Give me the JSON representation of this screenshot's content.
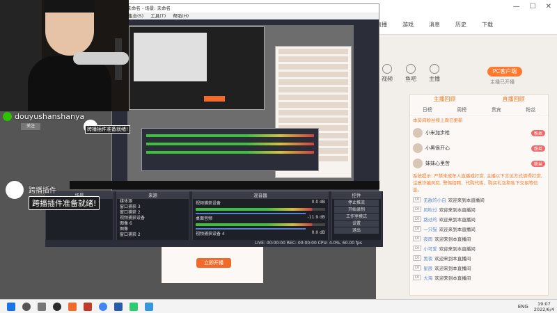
{
  "obs": {
    "title": "文件: 未命名 - 场景: 未命名",
    "menu": [
      "场景集合(S)",
      "工具(T)",
      "帮助(H)"
    ],
    "docks": {
      "scenes": {
        "header": "场景",
        "items": [
          "场景 2",
          "场景 3"
        ]
      },
      "sources": {
        "header": "来源",
        "items": [
          "媒体源",
          "窗口捕获 3",
          "窗口捕获 2",
          "视频捕获设备",
          "图像 6",
          "图像",
          "窗口捕获 2"
        ]
      },
      "mixer": {
        "header": "混音器",
        "rows": [
          {
            "name": "视频捕获设备",
            "level": "0.0 dB"
          },
          {
            "name": "桌面音频",
            "level": "-11.9 dB"
          },
          {
            "name": "视频捕获设备 4",
            "level": "0.0 dB"
          }
        ]
      },
      "controls": {
        "header": "控件",
        "buttons": [
          "停止推流",
          "开始录制",
          "工作室模式",
          "设置",
          "退出"
        ],
        "tab_left": "控件",
        "tab_right": "场景切换"
      }
    },
    "status": "LIVE: 00:00:00   REC: 00:00:00   CPU: 4.0%, 60.00 fps"
  },
  "overlay": {
    "wechat_name": "douyushanshanya",
    "wechat_sub": "关注",
    "ready_small": "跨播插件准备就绪!",
    "plugin_name": "跨播插件",
    "plugin_message": "跨播插件准备就绪!"
  },
  "page": {
    "nav": [
      "直播",
      "游戏",
      "消息",
      "历史",
      "下载"
    ],
    "anchor_links": [
      "视频",
      "鱼吧",
      "主播"
    ],
    "pc_button": "PC客户端",
    "pc_sub": "主播已开播"
  },
  "chat": {
    "tabs": [
      "主播回顾",
      "直播回顾"
    ],
    "subtabs": [
      "日榜",
      "周榜",
      "贵宾",
      "粉丝"
    ],
    "note": "本房间粉丝榜上周已更新",
    "ranks": [
      {
        "name": "小米加步枪",
        "tag": "粉丝"
      },
      {
        "name": "小黑很开心",
        "tag": "粉丝"
      },
      {
        "name": "妹妹心里苦",
        "tag": "粉丝"
      }
    ],
    "system_message": "系统提示: 严禁未成年人直播或打赏, 主播以下言论方式请得打赏, 注意诈骗风险, 警惕招聘、代购代练、购买礼包和私下交易等信息。",
    "messages": [
      {
        "lv": "LV",
        "user": "无敌的小白",
        "text": "欢迎来到本直播间"
      },
      {
        "lv": "LV",
        "user": "风吹过",
        "text": "欢迎来到本直播间"
      },
      {
        "lv": "LV",
        "user": "路过的",
        "text": "欢迎来到本直播间"
      },
      {
        "lv": "LV",
        "user": "一只猫",
        "text": "欢迎来到本直播间"
      },
      {
        "lv": "LV",
        "user": "夜雨",
        "text": "欢迎来到本直播间"
      },
      {
        "lv": "LV",
        "user": "小可爱",
        "text": "欢迎来到本直播间"
      },
      {
        "lv": "LV",
        "user": "黑夜",
        "text": "欢迎来到本直播间"
      },
      {
        "lv": "LV",
        "user": "星辰",
        "text": "欢迎来到本直播间"
      },
      {
        "lv": "LV",
        "user": "大海",
        "text": "欢迎来到本直播间"
      }
    ]
  },
  "lower": {
    "button": "立即开播"
  },
  "taskbar": {
    "lang": "ENG",
    "time": "19:07",
    "date": "2022/6/4"
  },
  "colors": {
    "accent": "#f06a2c",
    "obs_bg": "#2b2e38",
    "wechat": "#2dc100"
  }
}
